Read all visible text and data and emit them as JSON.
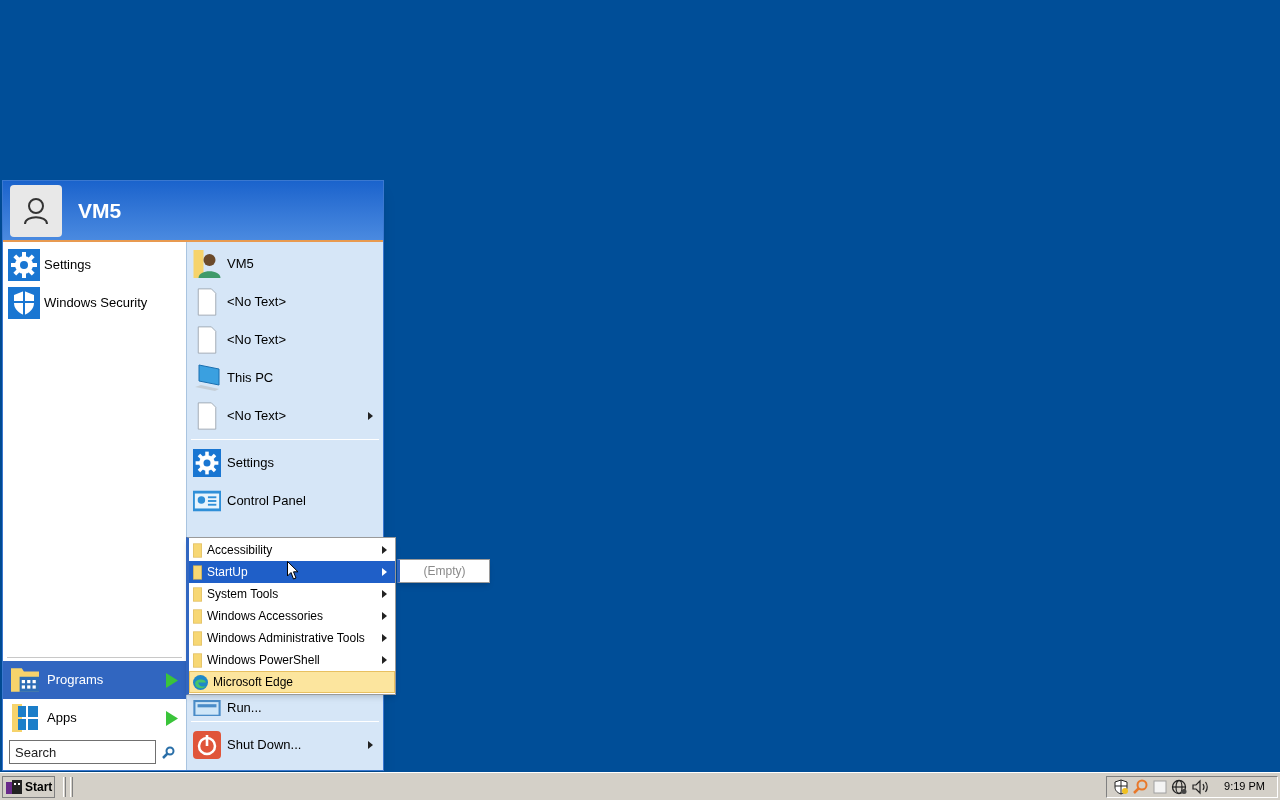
{
  "start_menu": {
    "user": {
      "name": "VM5"
    },
    "pinned": [
      {
        "label": "Settings"
      },
      {
        "label": "Windows Security"
      }
    ],
    "left_bottom": [
      {
        "label": "Programs",
        "selected": true
      },
      {
        "label": "Apps",
        "selected": false
      }
    ],
    "search": {
      "placeholder": "Search"
    },
    "right_items": [
      {
        "kind": "user",
        "label": "VM5",
        "submenu": false
      },
      {
        "kind": "document",
        "label": "<No Text>",
        "submenu": false
      },
      {
        "kind": "document",
        "label": "<No Text>",
        "submenu": false
      },
      {
        "kind": "computer",
        "label": "This PC",
        "submenu": false
      },
      {
        "kind": "document",
        "label": "<No Text>",
        "submenu": true
      },
      {
        "kind": "separator"
      },
      {
        "kind": "settings",
        "label": "Settings",
        "submenu": false
      },
      {
        "kind": "control-panel",
        "label": "Control Panel",
        "submenu": false
      }
    ],
    "right_bottom": [
      {
        "kind": "run",
        "label": "Run...",
        "submenu": false
      },
      {
        "kind": "separator"
      },
      {
        "kind": "power",
        "label": "Shut Down...",
        "submenu": true
      }
    ]
  },
  "programs_menu": [
    {
      "label": "Accessibility",
      "kind": "folder",
      "selected": false,
      "highlighted": false
    },
    {
      "label": "StartUp",
      "kind": "folder",
      "selected": true,
      "highlighted": false
    },
    {
      "label": "System Tools",
      "kind": "folder",
      "selected": false,
      "highlighted": false
    },
    {
      "label": "Windows Accessories",
      "kind": "folder",
      "selected": false,
      "highlighted": false
    },
    {
      "label": "Windows Administrative Tools",
      "kind": "folder",
      "selected": false,
      "highlighted": false
    },
    {
      "label": "Windows PowerShell",
      "kind": "folder",
      "selected": false,
      "highlighted": false
    },
    {
      "label": "Microsoft Edge",
      "kind": "app",
      "selected": false,
      "highlighted": true
    }
  ],
  "startup_menu": [
    {
      "label": "(Empty)",
      "disabled": true
    }
  ],
  "taskbar": {
    "start_label": "Start",
    "clock": "9:19 PM"
  }
}
